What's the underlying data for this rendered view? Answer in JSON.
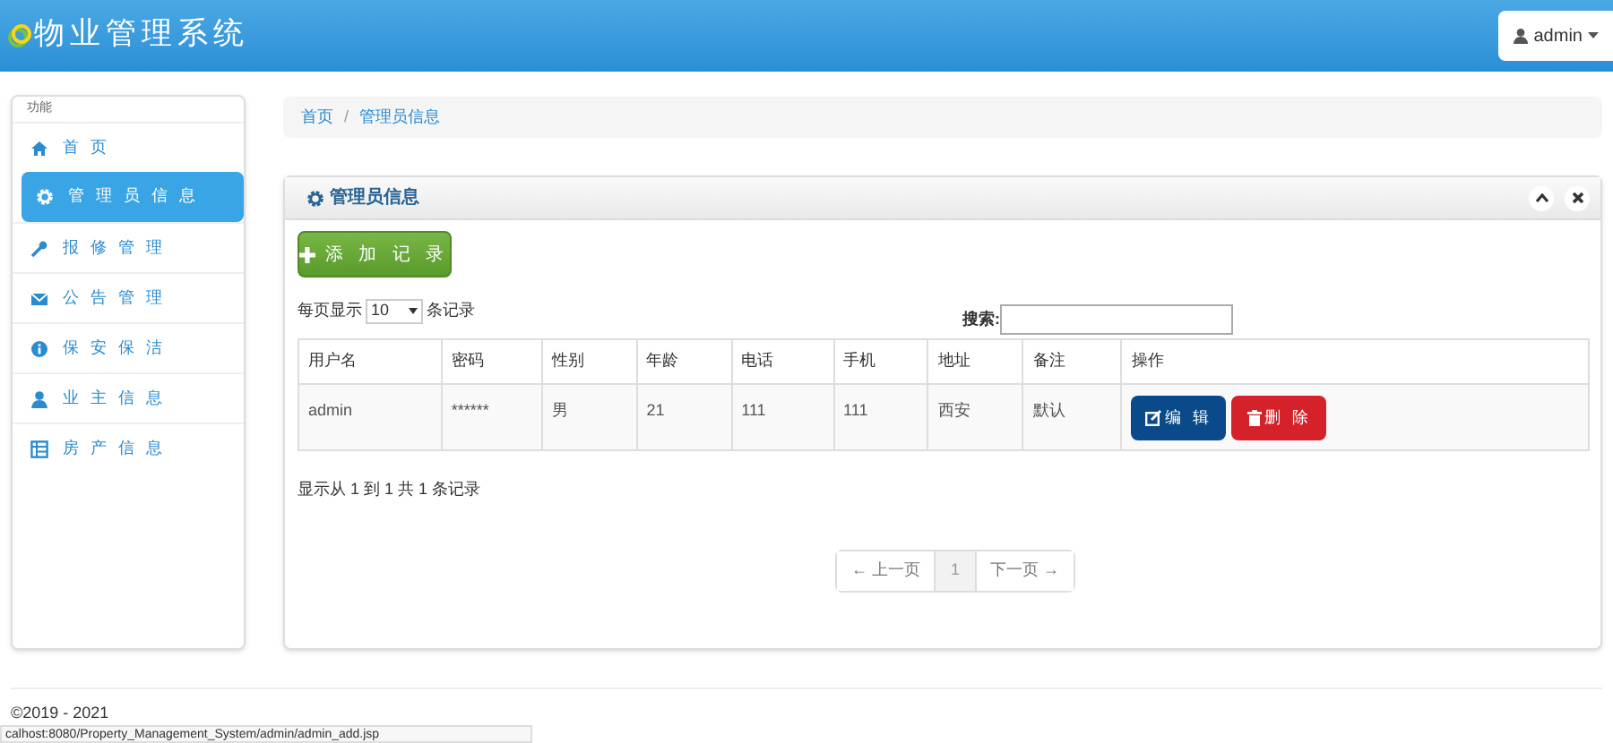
{
  "header": {
    "title": "物业管理系统",
    "user": "admin"
  },
  "sidebar": {
    "heading": "功能",
    "items": [
      {
        "label": "首 页",
        "kind": "home",
        "selected": false
      },
      {
        "label": "管 理 员 信 息",
        "kind": "gear",
        "selected": true
      },
      {
        "label": "报 修 管 理",
        "kind": "wrench",
        "selected": false
      },
      {
        "label": "公 告 管 理",
        "kind": "mail",
        "selected": false
      },
      {
        "label": "保 安 保 洁",
        "kind": "info",
        "selected": false
      },
      {
        "label": "业 主 信 息",
        "kind": "user",
        "selected": false
      },
      {
        "label": "房 产 信 息",
        "kind": "list",
        "selected": false
      }
    ]
  },
  "breadcrumb": {
    "separator": "/",
    "items": [
      "首页",
      "管理员信息"
    ]
  },
  "panel": {
    "title": "管理员信息",
    "add_button": "添 加 记 录",
    "page_size_prefix": "每页显示",
    "page_size": "10",
    "page_size_suffix": "条记录",
    "search_label": "搜索:",
    "table": {
      "columns": [
        "用户名",
        "密码",
        "性别",
        "年龄",
        "电话",
        "手机",
        "地址",
        "备注",
        "操作"
      ],
      "rows": [
        {
          "cells": [
            "admin",
            "******",
            "男",
            "21",
            "111",
            "111",
            "西安",
            "默认"
          ],
          "actions": [
            {
              "kind": "edit",
              "label": "编 辑"
            },
            {
              "kind": "delete",
              "label": "删 除"
            }
          ]
        }
      ]
    },
    "info": "显示从 1 到 1 共 1 条记录",
    "pagination": [
      {
        "label": "← 上一页",
        "selected": false
      },
      {
        "label": "1",
        "selected": true
      },
      {
        "label": "下一页 →",
        "selected": false
      }
    ]
  },
  "footer": {
    "copyright": "©2019 - 2021",
    "status_url": "calhost:8080/Property_Management_System/admin/admin_add.jsp"
  }
}
